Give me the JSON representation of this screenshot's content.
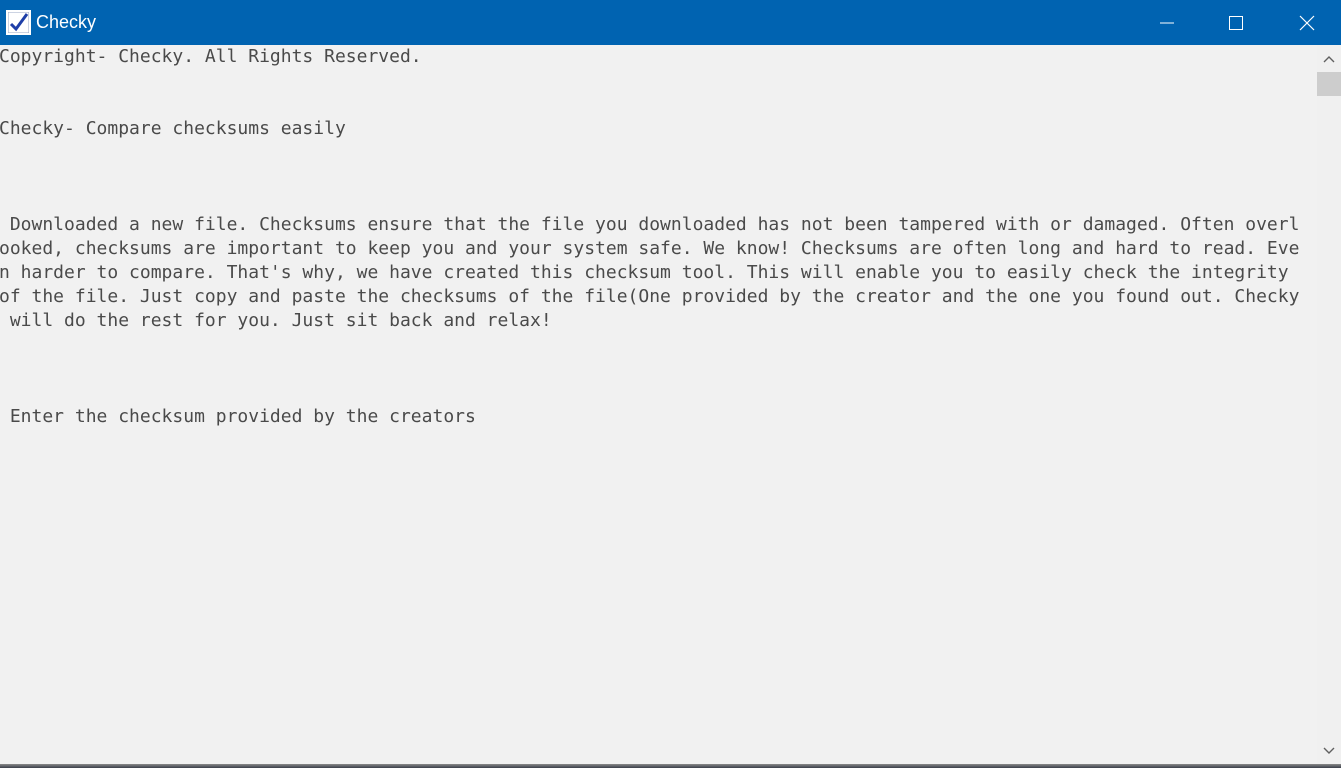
{
  "window": {
    "title": "Checky"
  },
  "content": {
    "copyright": "Copyright- Checky. All Rights Reserved.",
    "tagline": "Checky- Compare checksums easily",
    "description_lines": [
      " Downloaded a new file. Checksums ensure that the file you downloaded has not been tampered with or damaged. Often overl",
      "ooked, checksums are important to keep you and your system safe. We know! Checksums are often long and hard to read. Eve",
      "n harder to compare. That's why, we have created this checksum tool. This will enable you to easily check the integrity ",
      "of the file. Just copy and paste the checksums of the file(One provided by the creator and the one you found out. Checky",
      " will do the rest for you. Just sit back and relax!"
    ],
    "checksum_prompt": " Enter the checksum provided by the creators"
  },
  "icons": {
    "app": "checkbox-app-icon",
    "minimize": "minimize-icon",
    "maximize": "maximize-icon",
    "close": "close-icon",
    "scroll_up": "chevron-up-icon",
    "scroll_down": "chevron-down-icon"
  },
  "colors": {
    "titlebar": "#0063b1",
    "background": "#f1f1f1",
    "text": "#4a4a4a"
  }
}
